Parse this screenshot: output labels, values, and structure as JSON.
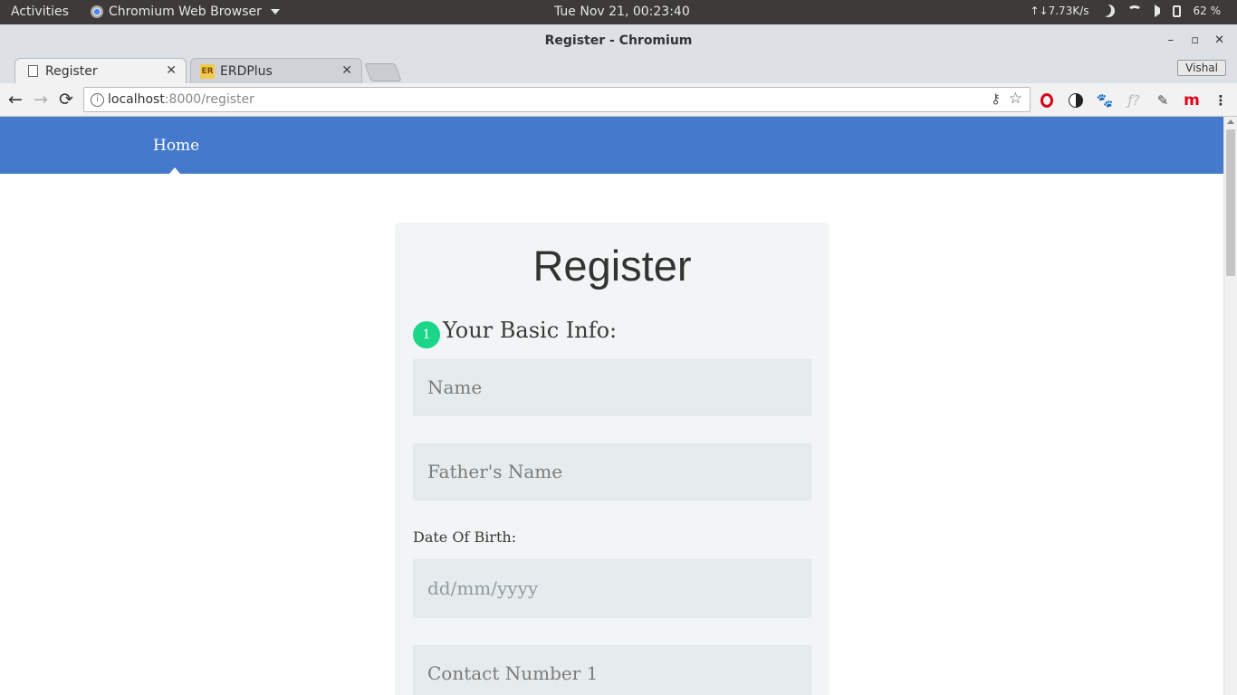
{
  "system_bar": {
    "activities": "Activities",
    "app_name": "Chromium Web Browser",
    "clock": "Tue Nov 21, 00:23:40",
    "net_speed": "↑↓7.73K/s",
    "battery": "62 %"
  },
  "window": {
    "title": "Register - Chromium",
    "profile_name": "Vishal"
  },
  "tabs": [
    {
      "label": "Register",
      "active": true
    },
    {
      "label": "ERDPlus",
      "favicon_text": "ER",
      "active": false
    }
  ],
  "address_bar": {
    "host": "localhost",
    "path": ":8000/register",
    "info_glyph": "i"
  },
  "icons": {
    "back": "←",
    "forward": "→",
    "reload": "⟳",
    "key": "⚷",
    "star": "☆",
    "gnome": "🐾",
    "fx": "ƒ?",
    "dropper": "✎",
    "m": "m",
    "menu": "⋮",
    "close": "✕",
    "minimize": "–",
    "maximize": "▫"
  },
  "navbar": {
    "home_label": "Home"
  },
  "form": {
    "title": "Register",
    "step_number": "1",
    "section_title": "Your Basic Info:",
    "name_placeholder": "Name",
    "father_name_placeholder": "Father's Name",
    "dob_label": "Date Of Birth:",
    "dob_placeholder": "dd/mm/yyyy",
    "contact1_placeholder": "Contact Number 1"
  },
  "colors": {
    "navbar": "#4479cb",
    "step_badge": "#1bd689",
    "card_bg": "#f2f5f5",
    "input_bg": "#e6ecec"
  }
}
